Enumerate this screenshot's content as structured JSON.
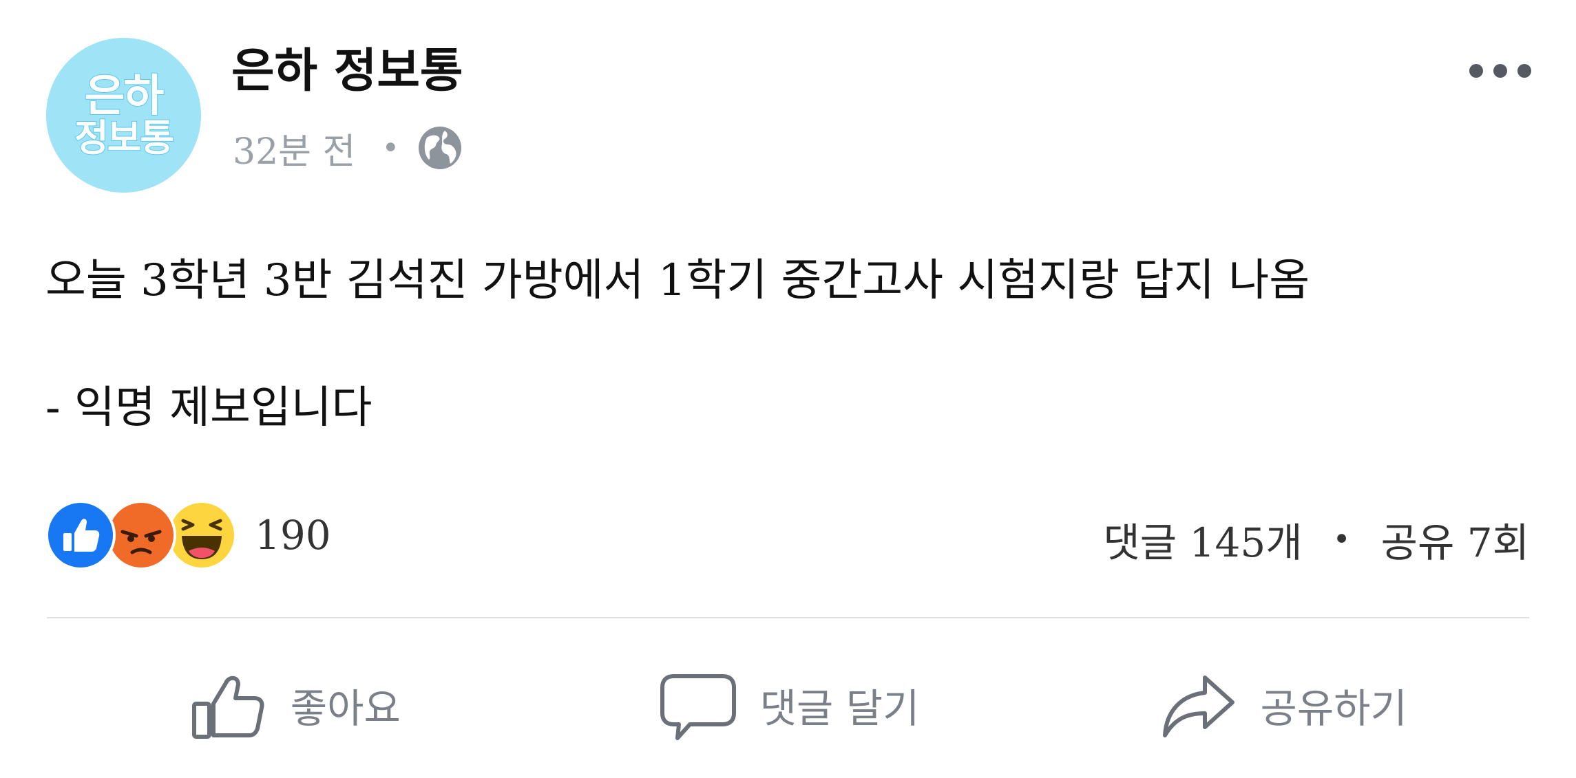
{
  "page": {
    "avatar_text_line1": "은하",
    "avatar_text_line2": "정보통",
    "name": "은하 정보통",
    "time": "32분 전",
    "meta_separator": "•",
    "privacy_icon": "globe-icon",
    "more_icon": "more-options-icon"
  },
  "post": {
    "line1": "오늘 3학년 3반 김석진 가방에서 1학기 중간고사 시험지랑 답지 나옴",
    "line2": "- 익명 제보입니다"
  },
  "reactions": {
    "icons": [
      "like-reaction-icon",
      "angry-reaction-icon",
      "haha-reaction-icon"
    ],
    "count": "190"
  },
  "stats": {
    "comments": "댓글 145개",
    "separator": "•",
    "shares": "공유 7회"
  },
  "actions": {
    "like_label": "좋아요",
    "comment_label": "댓글 달기",
    "share_label": "공유하기"
  },
  "colors": {
    "avatar_bg": "#9fe3f7",
    "like_blue": "#1877f2",
    "angry_orange": "#f06b28",
    "haha_yellow": "#fcd53f",
    "muted_text": "#7b8088"
  }
}
